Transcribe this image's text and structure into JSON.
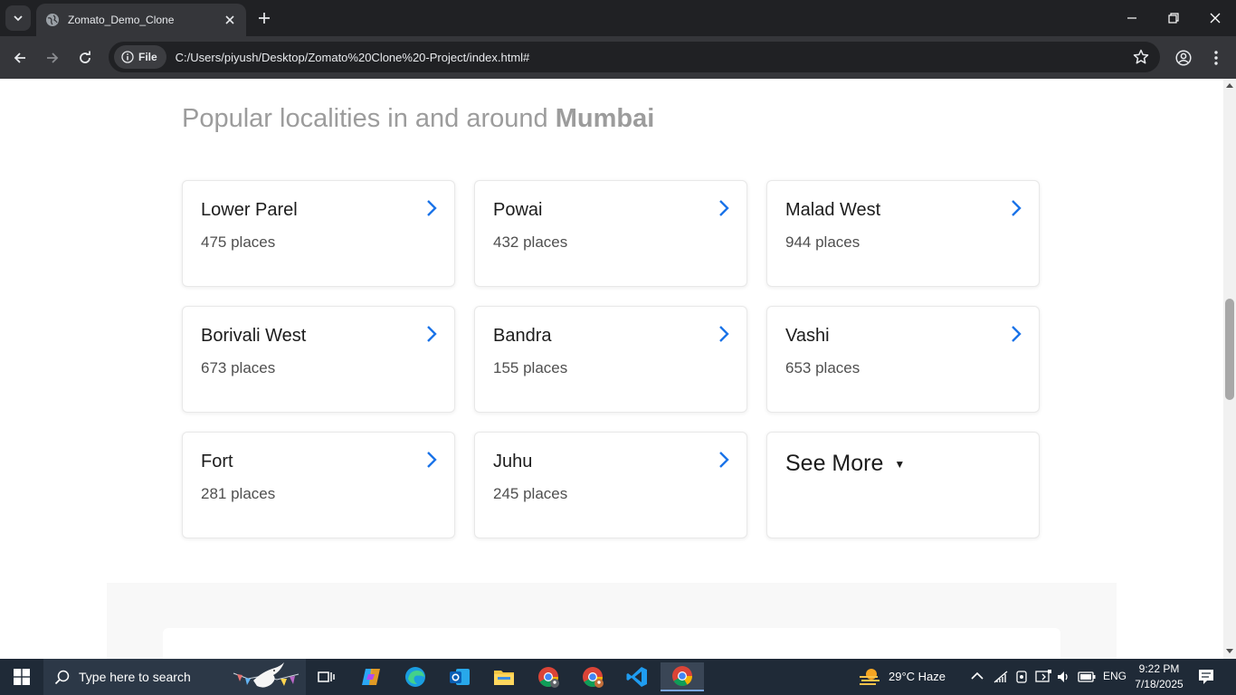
{
  "browser": {
    "tab_title": "Zomato_Demo_Clone",
    "chip_label": "File",
    "url": "C:/Users/piyush/Desktop/Zomato%20Clone%20-Project/index.html#"
  },
  "page": {
    "heading_prefix": "Popular localities in and around ",
    "heading_city": "Mumbai",
    "localities": [
      {
        "name": "Lower Parel",
        "count": "475 places"
      },
      {
        "name": "Powai",
        "count": "432 places"
      },
      {
        "name": "Malad West",
        "count": "944 places"
      },
      {
        "name": "Borivali West",
        "count": "673 places"
      },
      {
        "name": "Bandra",
        "count": "155 places"
      },
      {
        "name": "Vashi",
        "count": "653 places"
      },
      {
        "name": "Fort",
        "count": "281 places"
      },
      {
        "name": "Juhu",
        "count": "245 places"
      }
    ],
    "see_more_label": "See More",
    "see_more_caret": "▼",
    "accent_color": "#1a73e8"
  },
  "taskbar": {
    "search_placeholder": "Type here to search",
    "weather": "29°C  Haze",
    "language": "ENG",
    "time": "9:22 PM",
    "date": "7/18/2025"
  }
}
